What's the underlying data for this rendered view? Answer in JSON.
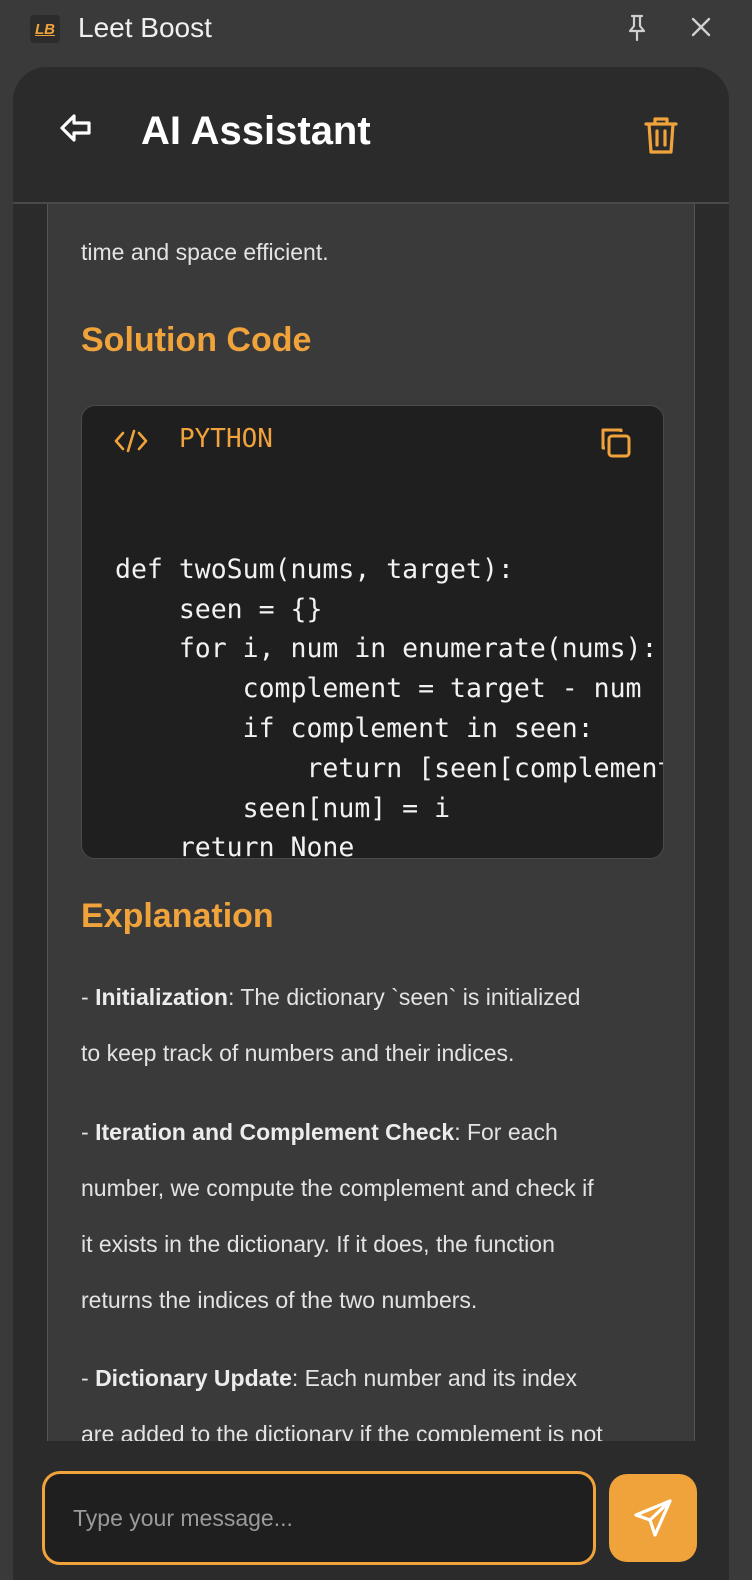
{
  "window": {
    "logo_text": "LB",
    "title": "Leet Boost"
  },
  "header": {
    "title": "AI Assistant"
  },
  "message": {
    "intro_tail": "time and space efficient.",
    "solution_heading": "Solution Code",
    "code": {
      "language": "PYTHON",
      "lines": [
        "def twoSum(nums, target):",
        "    seen = {}",
        "    for i, num in enumerate(nums):",
        "        complement = target - num",
        "        if complement in seen:",
        "            return [seen[complement], i]",
        "        seen[num] = i",
        "    return None"
      ]
    },
    "explanation_heading": "Explanation",
    "explanations": [
      {
        "term": "Initialization",
        "lines": [
          ": The dictionary `seen` is initialized",
          "to keep track of numbers and their indices."
        ]
      },
      {
        "term": "Iteration and Complement Check",
        "lines": [
          ": For each",
          "number, we compute the complement and check if",
          "it exists in the dictionary. If it does, the function",
          "returns the indices of the two numbers."
        ]
      },
      {
        "term": "Dictionary Update",
        "lines": [
          ": Each number and its index",
          "are added to the dictionary if the complement is not"
        ]
      }
    ]
  },
  "composer": {
    "placeholder": "Type your message..."
  },
  "colors": {
    "accent": "#f0a23b",
    "panel": "#2b2b2c",
    "message_bg": "#3a3a3b",
    "code_bg": "#1f1f20"
  },
  "icons": [
    "pin-icon",
    "close-icon",
    "back-icon",
    "trash-icon",
    "code-icon",
    "copy-icon",
    "send-icon"
  ]
}
